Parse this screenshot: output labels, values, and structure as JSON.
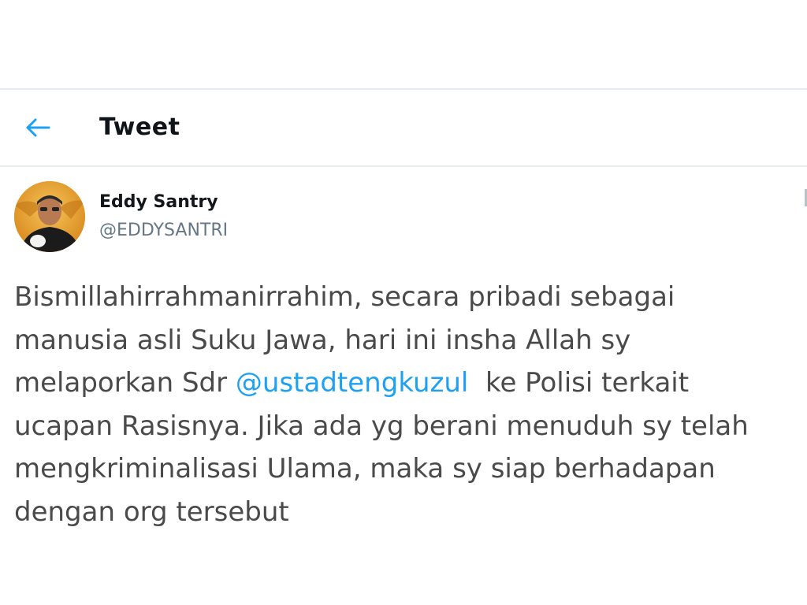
{
  "header": {
    "title": "Tweet",
    "back_icon": "arrow-left-icon"
  },
  "author": {
    "name": "Eddy Santry",
    "handle": "@EDDYSANTRI",
    "avatar_icon": "avatar-photo"
  },
  "tweet": {
    "line1": "Bismillahirrahmanirrahim, secara pribadi sebagai",
    "line2": "manusia asli Suku Jawa, hari ini insha Allah sy",
    "line3_before": "melaporkan Sdr ",
    "mention": "@ustadtengkuzul",
    "line3_after": "  ke Polisi terkait",
    "line4": "ucapan Rasisnya. Jika ada yg berani menuduh sy telah",
    "line5": "mengkriminalisasi Ulama, maka sy siap berhadapan",
    "line6": "dengan org tersebut"
  },
  "colors": {
    "accent": "#1da1f2",
    "divider": "#e6ecf0",
    "handle": "#657786",
    "text": "#4a4a4a"
  }
}
